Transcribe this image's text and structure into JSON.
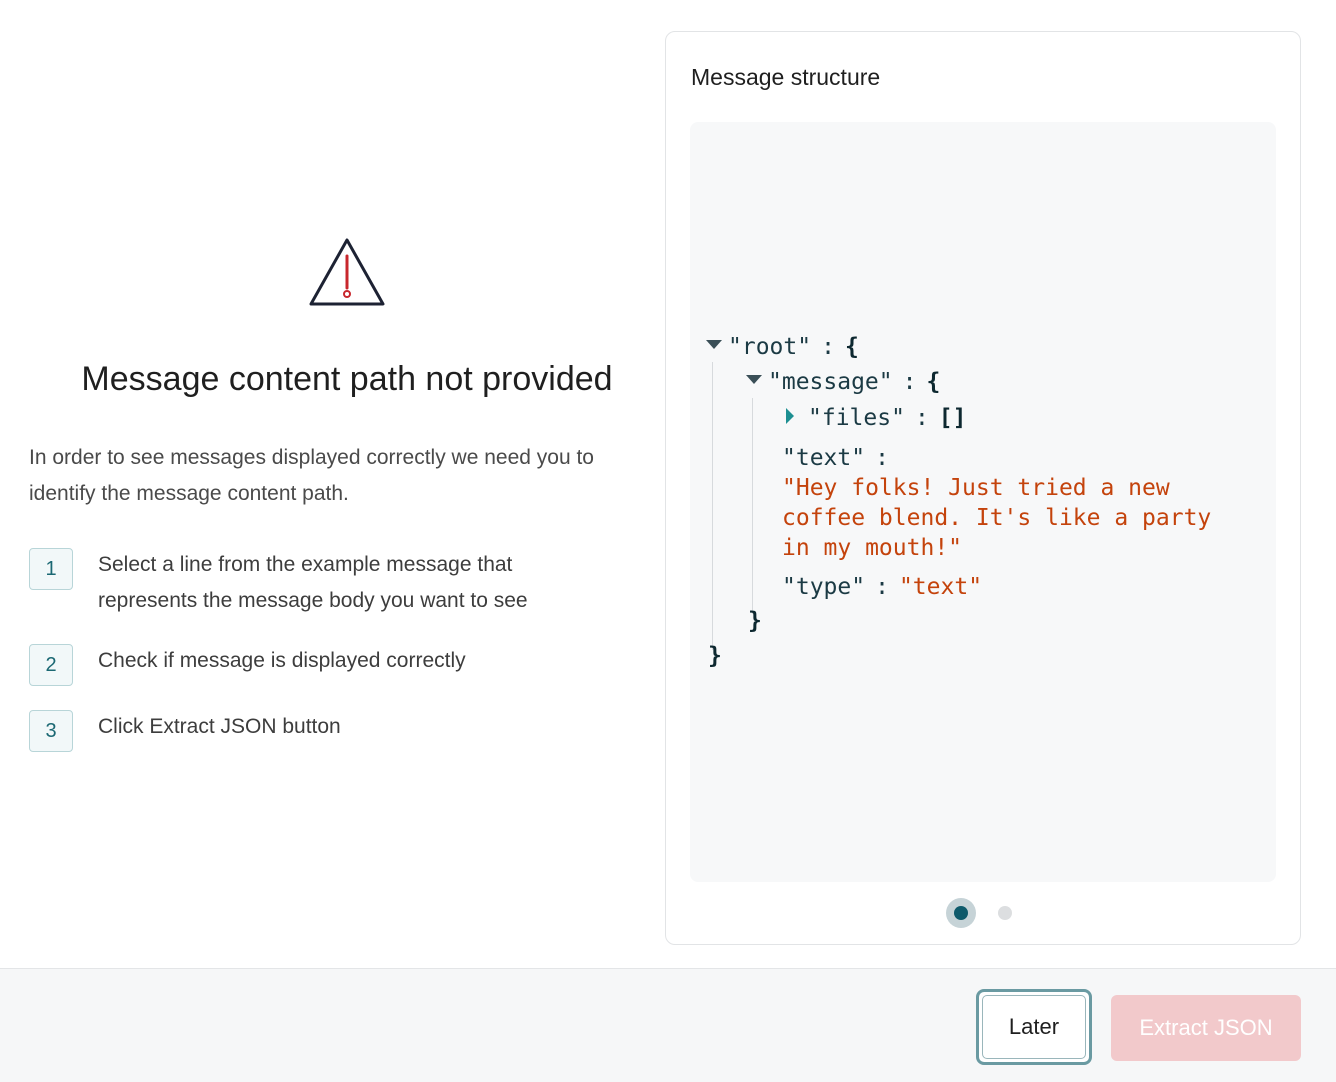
{
  "left": {
    "heading": "Message content path not provided",
    "intro": "In order to see messages displayed correctly we need you to identify the message content path.",
    "steps": [
      {
        "number": "1",
        "text": "Select a line from the example message that represents the message body you want to see"
      },
      {
        "number": "2",
        "text": "Check if message is displayed correctly"
      },
      {
        "number": "3",
        "text": "Click Extract JSON button"
      }
    ]
  },
  "card": {
    "title": "Message structure",
    "json": {
      "root_key": "\"root\"",
      "message_key": "\"message\"",
      "files_key": "\"files\"",
      "files_value": "[]",
      "text_key": "\"text\"",
      "text_value_lines": [
        "\"Hey folks! Just tried a new",
        "coffee blend. It's like a party",
        "in my mouth!\""
      ],
      "type_key": "\"type\"",
      "type_value": "\"text\"",
      "open_brace": "{",
      "close_brace": "}",
      "colon": ":"
    },
    "pagination": {
      "total": 2,
      "active": 1
    }
  },
  "footer": {
    "later_label": "Later",
    "extract_label": "Extract JSON"
  },
  "colors": {
    "accent": "#0e5a6b",
    "string_value": "#c4430c",
    "warning_mark": "#c8272d",
    "extract_disabled_bg": "#f2c9cb"
  },
  "icons": {
    "warning": "warning-triangle-icon",
    "expanded": "caret-down-icon",
    "collapsed": "caret-right-icon"
  }
}
